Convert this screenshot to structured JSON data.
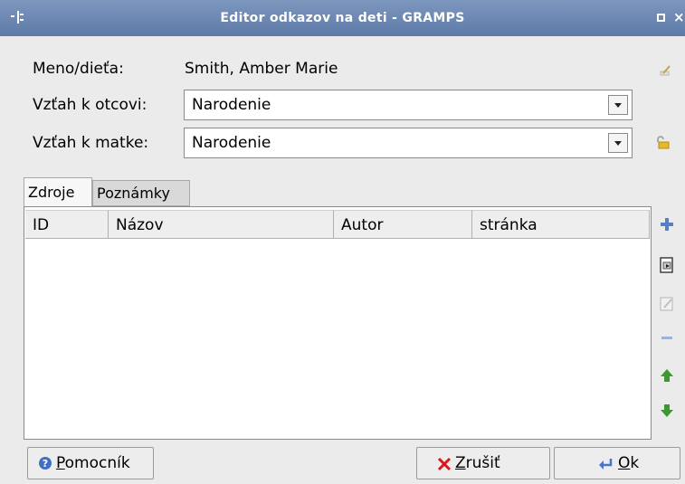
{
  "window": {
    "title": "Editor odkazov na deti - GRAMPS"
  },
  "form": {
    "child_label": "Meno/dieťa:",
    "child_value": "Smith, Amber Marie",
    "father_label": "Vzťah k otcovi:",
    "father_value": "Narodenie",
    "mother_label": "Vzťah k matke:",
    "mother_value": "Narodenie"
  },
  "tabs": [
    {
      "label": "Zdroje",
      "active": true
    },
    {
      "label": "Poznámky",
      "active": false
    }
  ],
  "table": {
    "columns": [
      "ID",
      "Názov",
      "Autor",
      "stránka"
    ],
    "rows": []
  },
  "buttons": {
    "help_mnemonic": "P",
    "help_rest": "omocník",
    "cancel_mnemonic": "Z",
    "cancel_rest": "rušiť",
    "ok_mnemonic": "O",
    "ok_rest": "k"
  },
  "icons": {
    "add": "add-icon",
    "share": "share-existing-icon",
    "edit": "edit-icon",
    "remove": "remove-icon",
    "up": "move-up-icon",
    "down": "move-down-icon",
    "cancel": "cancel-x-icon",
    "ok": "ok-arrow-icon",
    "help": "help-icon"
  },
  "colors": {
    "titlebar": "#6b86b1",
    "add_blue": "#5b7fc2",
    "arrow_green": "#3a9a2e",
    "cancel_red": "#d8161b"
  }
}
